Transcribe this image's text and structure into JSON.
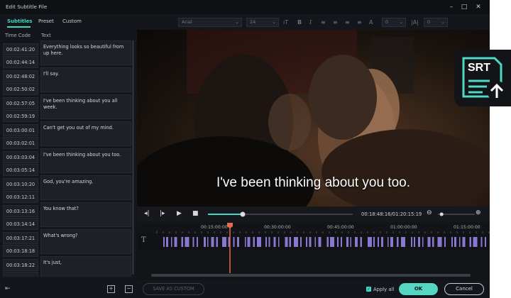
{
  "window": {
    "title": "Edit Subtitle File"
  },
  "tabs": [
    {
      "label": "Subtitles",
      "active": true
    },
    {
      "label": "Preset",
      "active": false
    },
    {
      "label": "Custom",
      "active": false
    }
  ],
  "columns": {
    "time": "Time Code",
    "text": "Text"
  },
  "subtitles": [
    {
      "start": "00:02:41:20",
      "end": "00:02:44:14",
      "text": "Everything looks so beautiful from up here."
    },
    {
      "start": "00:02:48:02",
      "end": "00:02:50:02",
      "text": "I'll say."
    },
    {
      "start": "00:02:57:05",
      "end": "00:02:59:19",
      "text": "I've been thinking about you all week."
    },
    {
      "start": "00:03:00:01",
      "end": "00:03:02:01",
      "text": "Can't get you out of my mind."
    },
    {
      "start": "00:03:03:04",
      "end": "00:03:05:14",
      "text": "I've been thinking about you too."
    },
    {
      "start": "00:03:10:20",
      "end": "00:03:12:11",
      "text": "God, you're amazing."
    },
    {
      "start": "00:03:13:16",
      "end": "00:03:14:14",
      "text": "You know that?"
    },
    {
      "start": "00:03:17:21",
      "end": "00:03:18:18",
      "text": "What's wrong?"
    },
    {
      "start": "00:03:18:22",
      "end": "",
      "text": "It's just,"
    }
  ],
  "toolbar": {
    "font": "Arial",
    "size": "24",
    "opacity": "0",
    "spacing": "0"
  },
  "preview": {
    "subtitle": "I've been thinking about you too."
  },
  "player": {
    "timecode": "00:18:48:16/01:20:15:19",
    "progress": 0.24,
    "zoom": 0.1
  },
  "timeline": {
    "ruler": [
      "00:15:00:00",
      "00:30:00:00",
      "00:45:00:00",
      "01:00:00:00",
      "01:15:00:00"
    ]
  },
  "footer": {
    "save_custom": "SAVE AS CUSTOM",
    "apply_all": "Apply all",
    "ok": "OK",
    "cancel": "Cancel"
  },
  "badge": {
    "label": "SRT"
  },
  "colors": {
    "accent": "#3ed8c4",
    "clip": "#8a78d0",
    "playhead": "#e76a4b"
  }
}
